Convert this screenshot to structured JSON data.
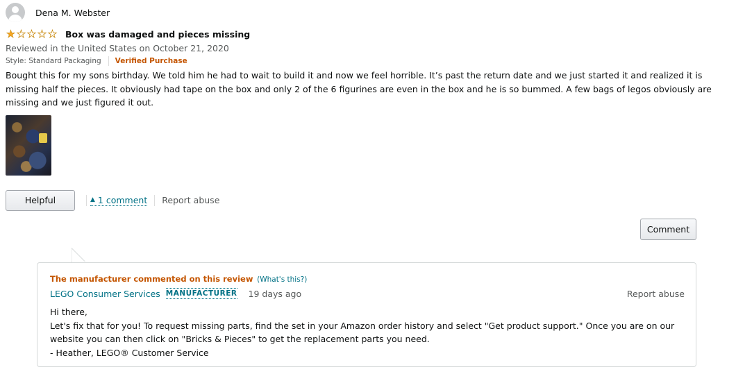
{
  "review": {
    "profile_name": "Dena M. Webster",
    "rating": 1,
    "rating_max": 5,
    "title": "Box was damaged and pieces missing",
    "date": "Reviewed in the United States on October 21, 2020",
    "style": "Style: Standard Packaging",
    "verified": "Verified Purchase",
    "body": "Bought this for my sons birthday. We told him he had to wait to build it and now we feel horrible. It’s past the return date and we just started it and realized it is missing half the pieces. It obviously had tape on the box and only 2 of the 6 figurines are even in the box and he is so bummed. A few bags of legos obviously are missing and we just figured it out.",
    "helpful_label": "Helpful",
    "comment_toggle_label": "1 comment",
    "report_label": "Report abuse",
    "comment_button_label": "Comment"
  },
  "manufacturer_comment": {
    "heading": "The manufacturer commented on this review",
    "whats_this": "(What's this?)",
    "name": "LEGO Consumer Services",
    "badge": "MANUFACTURER",
    "time": "19 days ago",
    "report_label": "Report abuse",
    "lines": [
      "Hi there,",
      "Let's fix that for you! To request missing parts, find the set in your Amazon order history and select \"Get product support.\" Once you are on our website you can then click on \"Bricks & Pieces\" to get the replacement parts you need.",
      "- Heather, LEGO® Customer Service"
    ]
  },
  "colors": {
    "link": "#007185",
    "verified": "#c45500",
    "star": "#f6a623",
    "muted": "#565959"
  },
  "icons": {
    "avatar": "user-avatar-icon",
    "star_full": "star-filled-icon",
    "star_empty": "star-outline-icon",
    "caret": "caret-up-icon"
  }
}
